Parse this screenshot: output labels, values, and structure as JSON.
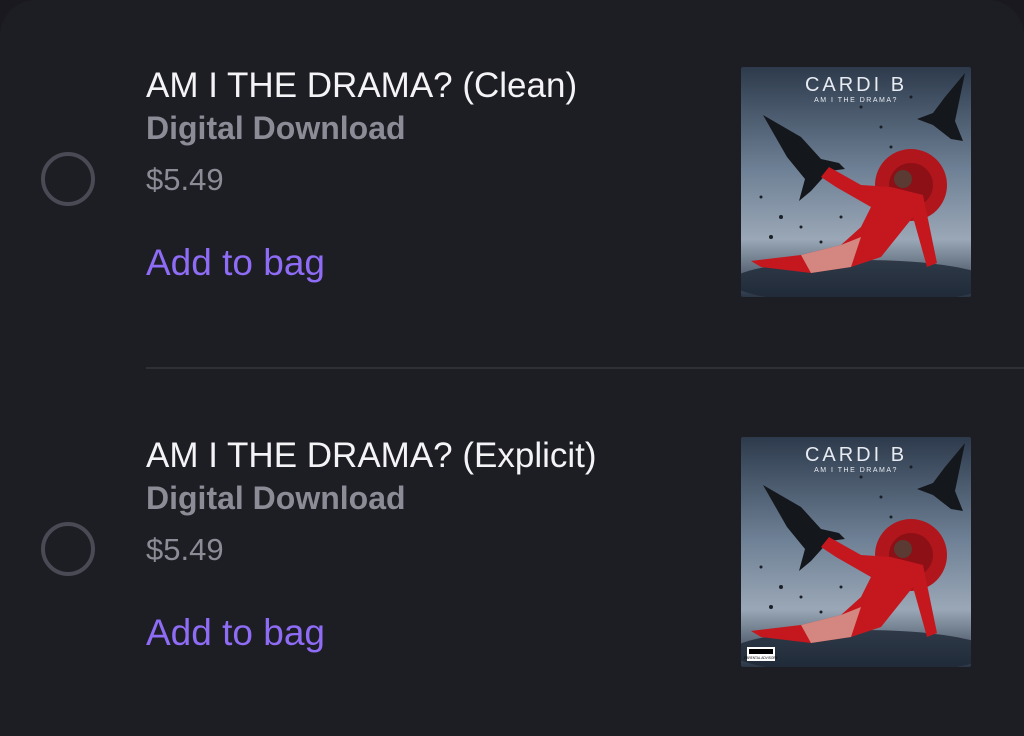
{
  "items": [
    {
      "title": "AM I THE DRAMA? (Clean)",
      "format": "Digital Download",
      "price": "$5.49",
      "action": "Add to bag",
      "selected": false,
      "cover": {
        "artist": "CARDI B",
        "album": "AM I THE DRAMA?",
        "advisory": ""
      }
    },
    {
      "title": "AM I THE DRAMA? (Explicit)",
      "format": "Digital Download",
      "price": "$5.49",
      "action": "Add to bag",
      "selected": false,
      "cover": {
        "artist": "CARDI B",
        "album": "AM I THE DRAMA?",
        "advisory": "PARENTAL ADVISORY"
      }
    }
  ],
  "colors": {
    "background": "#1d1d24",
    "title": "#f4f4f7",
    "secondary": "#8c8c97",
    "accent": "#8e6cf5",
    "divider": "#2f2f38"
  }
}
